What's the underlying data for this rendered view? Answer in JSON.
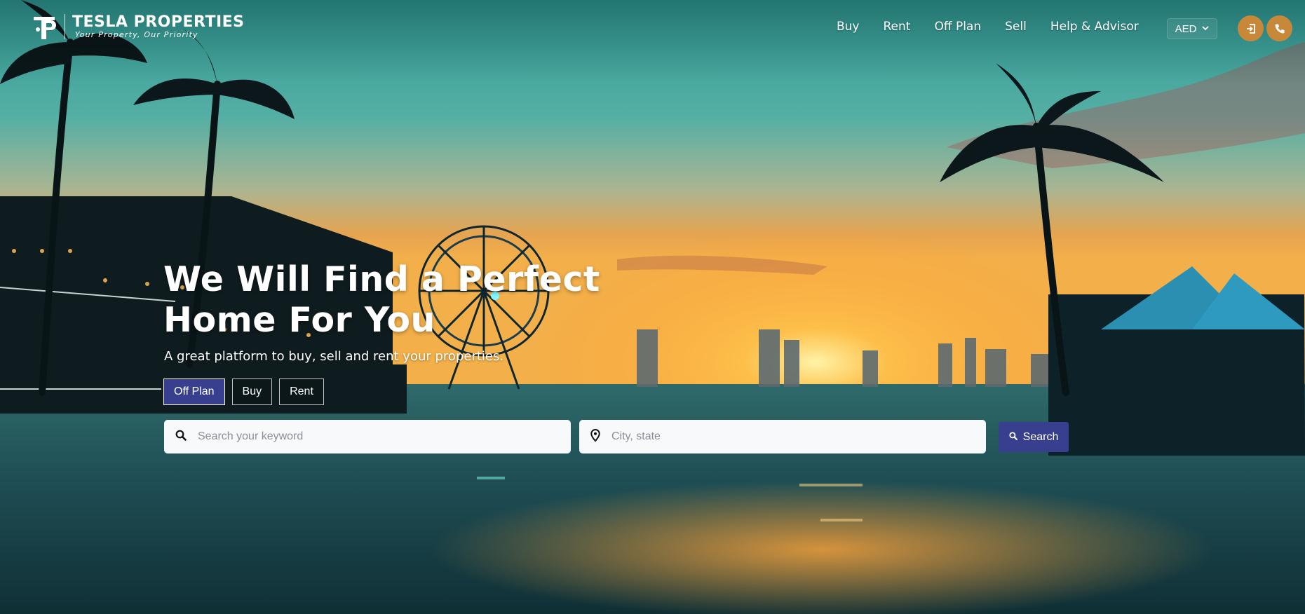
{
  "brand": {
    "name": "TESLA PROPERTIES",
    "tagline": "Your Property, Our Priority"
  },
  "nav": {
    "links": [
      "Buy",
      "Rent",
      "Off Plan",
      "Sell",
      "Help & Advisor"
    ],
    "currency": "AED"
  },
  "hero": {
    "headline_line1": "We Will Find a Perfect",
    "headline_line2": "Home For You",
    "subheadline": "A great platform to buy, sell and rent your properties.",
    "tabs": [
      "Off Plan",
      "Buy",
      "Rent"
    ],
    "active_tab": "Off Plan"
  },
  "search": {
    "keyword_placeholder": "Search your keyword",
    "location_placeholder": "City, state",
    "button_label": "Search"
  },
  "colors": {
    "primary": "#393f8f",
    "accent": "#c8883a",
    "text_light": "#ffffff",
    "field_bg": "#f8f9fb"
  },
  "icons": {
    "logo": "logo-icon",
    "login": "login-icon",
    "phone": "phone-icon",
    "search": "search-icon",
    "location": "location-pin-icon",
    "chevron": "chevron-down-icon"
  }
}
